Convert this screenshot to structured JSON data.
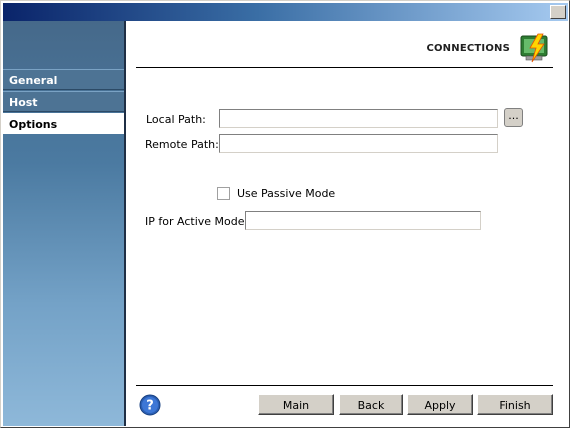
{
  "header": {
    "title": "CONNECTIONS",
    "icon": "connections-icon"
  },
  "sidebar": {
    "items": [
      {
        "label": "General",
        "active": false
      },
      {
        "label": "Host",
        "active": false
      },
      {
        "label": "Options",
        "active": true
      }
    ]
  },
  "form": {
    "local_path_label": "Local Path:",
    "local_path_value": "",
    "browse_label": "...",
    "remote_path_label": "Remote Path:",
    "remote_path_value": "",
    "passive_mode_label": "Use Passive Mode",
    "passive_mode_checked": false,
    "ip_active_label": "IP for Active Mode:",
    "ip_active_value": ""
  },
  "footer": {
    "help_icon": "help-icon",
    "buttons": {
      "main": "Main",
      "back": "Back",
      "apply": "Apply",
      "finish": "Finish"
    }
  },
  "colors": {
    "sidebar_top": "#46698a",
    "sidebar_bottom": "#8eb8d9",
    "nav_item": "#4d7394",
    "titlebar_start": "#0a246a",
    "titlebar_end": "#a6caf0",
    "button_face": "#d4d0c8"
  }
}
